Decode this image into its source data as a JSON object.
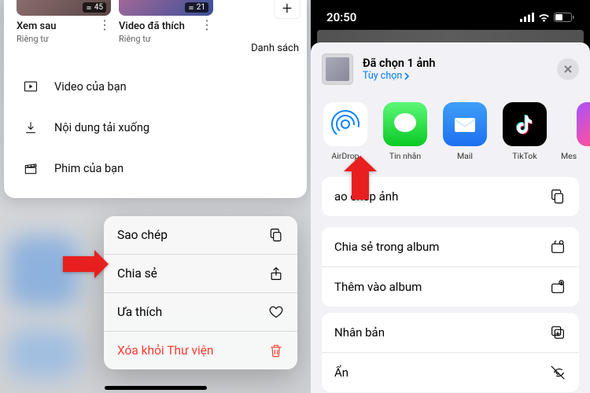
{
  "left": {
    "thumbs": [
      {
        "title": "Xem sau",
        "sub": "Riêng tư",
        "count": "45"
      },
      {
        "title": "Video đã thích",
        "sub": "Riêng tư",
        "count": "21"
      }
    ],
    "danh_sach": "Danh sách",
    "list": [
      {
        "label": "Video của bạn"
      },
      {
        "label": "Nội dung tải xuống"
      },
      {
        "label": "Phim của bạn"
      }
    ],
    "ctx": {
      "copy": "Sao chép",
      "share": "Chia sẻ",
      "fav": "Ưa thích",
      "del": "Xóa khỏi Thư viện"
    }
  },
  "right": {
    "time": "20:50",
    "header": {
      "title": "Đã chọn 1 ảnh",
      "options": "Tùy chọn"
    },
    "apps": [
      {
        "label": "AirDrop"
      },
      {
        "label": "Tin nhắn"
      },
      {
        "label": "Mail"
      },
      {
        "label": "TikTok"
      },
      {
        "label": "Mes"
      }
    ],
    "actions": {
      "copy_img": "ao chép ảnh",
      "share_album": "Chia sẻ trong album",
      "add_album": "Thêm vào album",
      "dup": "Nhân bản",
      "hide": "Ẩn"
    }
  }
}
